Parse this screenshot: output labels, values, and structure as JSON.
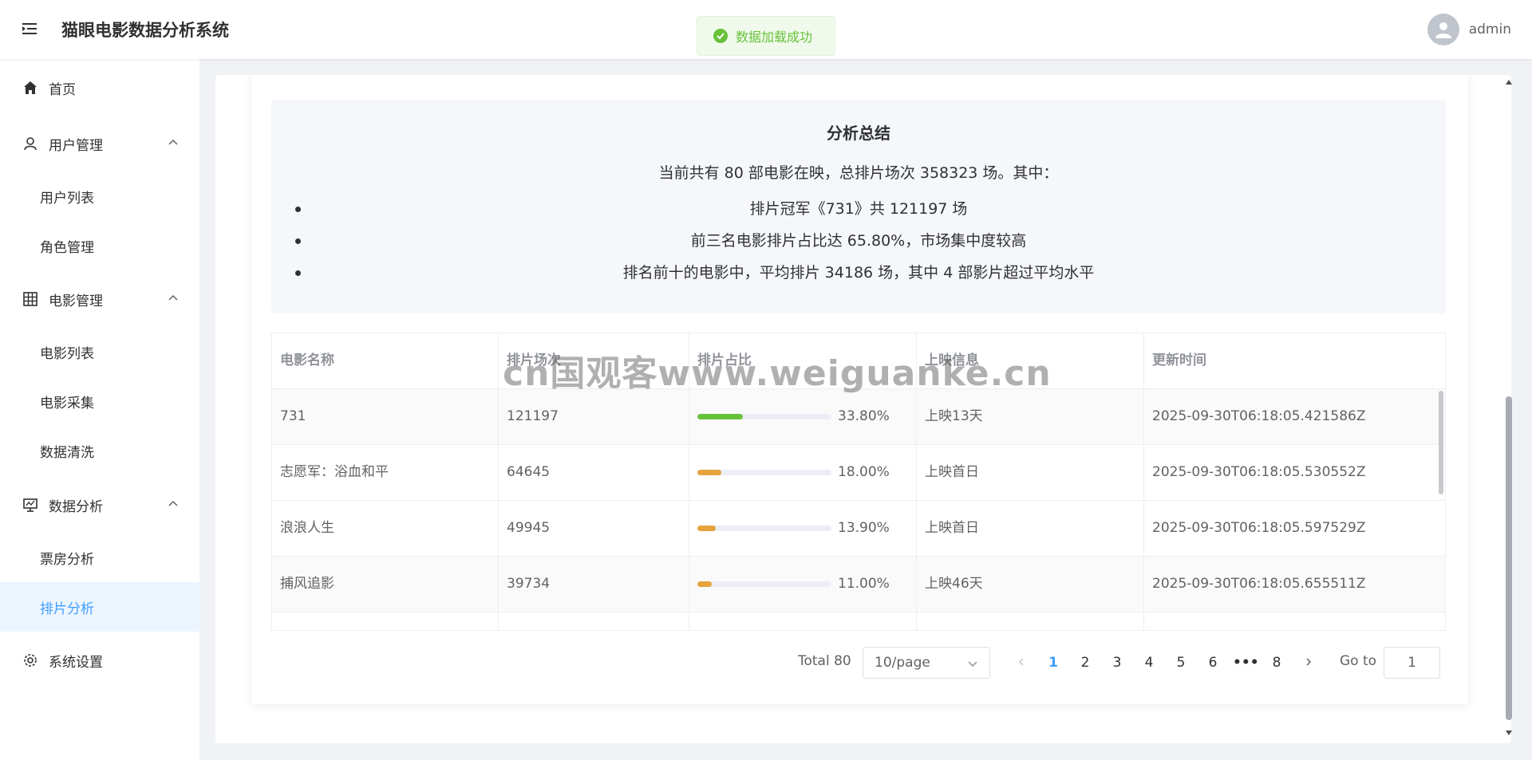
{
  "app": {
    "title": "猫眼电影数据分析系统",
    "user": "admin"
  },
  "toast": {
    "text": "数据加载成功"
  },
  "sidebar": {
    "home": "首页",
    "user_mgmt": "用户管理",
    "user_list": "用户列表",
    "role_mgmt": "角色管理",
    "movie_mgmt": "电影管理",
    "movie_list": "电影列表",
    "movie_collect": "电影采集",
    "data_clean": "数据清洗",
    "data_analysis": "数据分析",
    "box_office": "票房分析",
    "schedule": "排片分析",
    "settings": "系统设置"
  },
  "summary": {
    "title": "分析总结",
    "line": "当前共有 80 部电影在映，总排片场次 358323 场。其中：",
    "bullets": [
      "排片冠军《731》共 121197 场",
      "前三名电影排片占比达 65.80%，市场集中度较高",
      "排名前十的电影中，平均排片 34186 场，其中 4 部影片超过平均水平"
    ]
  },
  "table": {
    "headers": [
      "电影名称",
      "排片场次",
      "排片占比",
      "上映信息",
      "更新时间"
    ],
    "rows": [
      {
        "name": "731",
        "count": "121197",
        "pct": 33.8,
        "pct_label": "33.80%",
        "color": "#67c23a",
        "info": "上映13天",
        "time": "2025-09-30T06:18:05.421586Z"
      },
      {
        "name": "志愿军：浴血和平",
        "count": "64645",
        "pct": 18.0,
        "pct_label": "18.00%",
        "color": "#e6a23c",
        "info": "上映首日",
        "time": "2025-09-30T06:18:05.530552Z"
      },
      {
        "name": "浪浪人生",
        "count": "49945",
        "pct": 13.9,
        "pct_label": "13.90%",
        "color": "#e6a23c",
        "info": "上映首日",
        "time": "2025-09-30T06:18:05.597529Z"
      },
      {
        "name": "捕风追影",
        "count": "39734",
        "pct": 11.0,
        "pct_label": "11.00%",
        "color": "#e6a23c",
        "info": "上映46天",
        "time": "2025-09-30T06:18:05.655511Z"
      }
    ]
  },
  "pagination": {
    "total": "Total 80",
    "page_size": "10/page",
    "pages": [
      "1",
      "2",
      "3",
      "4",
      "5",
      "6",
      "8"
    ],
    "ellipsis": "•••",
    "current": "1",
    "goto_label": "Go to",
    "goto_value": "1"
  },
  "watermark": "cn国观客www.weiguanke.cn"
}
